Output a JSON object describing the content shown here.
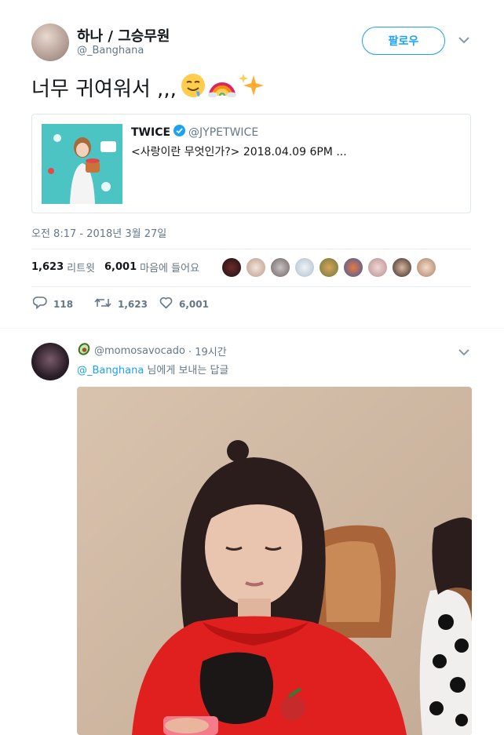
{
  "tweet": {
    "author_name": "하나 / 그승무원",
    "author_handle": "@_Banghana",
    "follow_label": "팔로우",
    "text": "너무 귀여워서 ,,,",
    "emojis": [
      "drooling-face-emoji",
      "rainbow-emoji",
      "sparkles-emoji"
    ],
    "quoted": {
      "name": "TWICE",
      "handle": "@JYPETWICE",
      "text": "<사랑이란 무엇인가?> 2018.04.09 6PM ..."
    },
    "timestamp": "오전 8:17 - 2018년 3월 27일",
    "retweets_count": "1,623",
    "retweets_label": "리트윗",
    "likes_count": "6,001",
    "likes_label": "마음에 들어요",
    "actions": {
      "reply_count": "118",
      "retweet_count": "1,623",
      "like_count": "6,001"
    }
  },
  "reply": {
    "emoji": "avocado-emoji",
    "handle": "@momosavocado",
    "time": "· 19시간",
    "replying_handle": "@_Banghana",
    "replying_suffix": " 님에게 보내는 답글"
  },
  "colors": {
    "accent": "#1da1f2",
    "secondary_text": "#657786",
    "divider": "#e6ecf0",
    "verified": "#1da1f2"
  }
}
